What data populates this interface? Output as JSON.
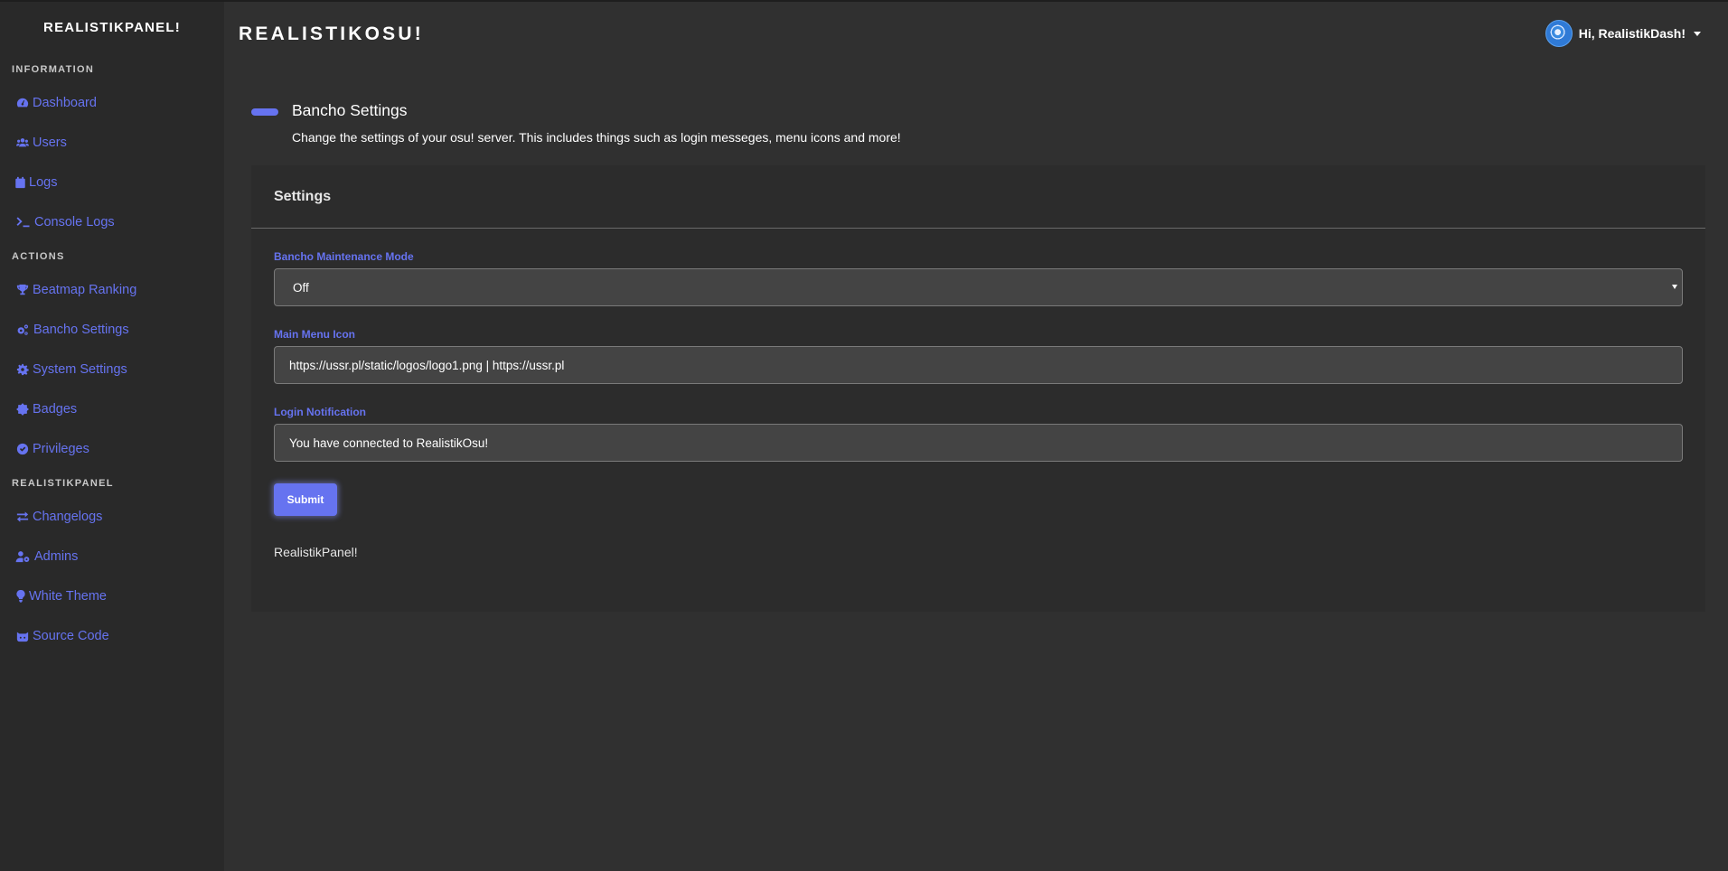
{
  "sidebar": {
    "brand": "REALISTIKPANEL!",
    "sections": [
      {
        "title": "INFORMATION",
        "items": [
          {
            "label": "Dashboard",
            "icon": "tachometer-icon"
          },
          {
            "label": "Users",
            "icon": "users-icon"
          },
          {
            "label": "Logs",
            "icon": "calendar-icon"
          },
          {
            "label": "Console Logs",
            "icon": "terminal-icon"
          }
        ]
      },
      {
        "title": "ACTIONS",
        "items": [
          {
            "label": "Beatmap Ranking",
            "icon": "trophy-icon"
          },
          {
            "label": "Bancho Settings",
            "icon": "cogs-icon"
          },
          {
            "label": "System Settings",
            "icon": "cog-icon"
          },
          {
            "label": "Badges",
            "icon": "certificate-icon"
          },
          {
            "label": "Privileges",
            "icon": "check-circle-icon"
          }
        ]
      },
      {
        "title": "REALISTIKPANEL",
        "items": [
          {
            "label": "Changelogs",
            "icon": "exchange-icon"
          },
          {
            "label": "Admins",
            "icon": "user-cog-icon"
          },
          {
            "label": "White Theme",
            "icon": "lightbulb-icon"
          },
          {
            "label": "Source Code",
            "icon": "github-icon"
          }
        ]
      }
    ]
  },
  "header": {
    "app_title": "REALISTIKOSU!",
    "user_greeting": "Hi, RealistikDash!"
  },
  "page": {
    "title": "Bancho Settings",
    "description": "Change the settings of your osu! server. This includes things such as login messeges, menu icons and more!"
  },
  "card": {
    "title": "Settings",
    "fields": {
      "maintenance": {
        "label": "Bancho Maintenance Mode",
        "value": "Off"
      },
      "menu_icon": {
        "label": "Main Menu Icon",
        "value": "https://ussr.pl/static/logos/logo1.png | https://ussr.pl"
      },
      "login_notification": {
        "label": "Login Notification",
        "value": "You have connected to RealistikOsu!"
      }
    },
    "submit_label": "Submit",
    "footer": "RealistikPanel!"
  },
  "colors": {
    "accent": "#6673f0",
    "sidebar_bg": "#292929",
    "main_bg": "#303030",
    "card_bg": "#2c2c2c"
  }
}
